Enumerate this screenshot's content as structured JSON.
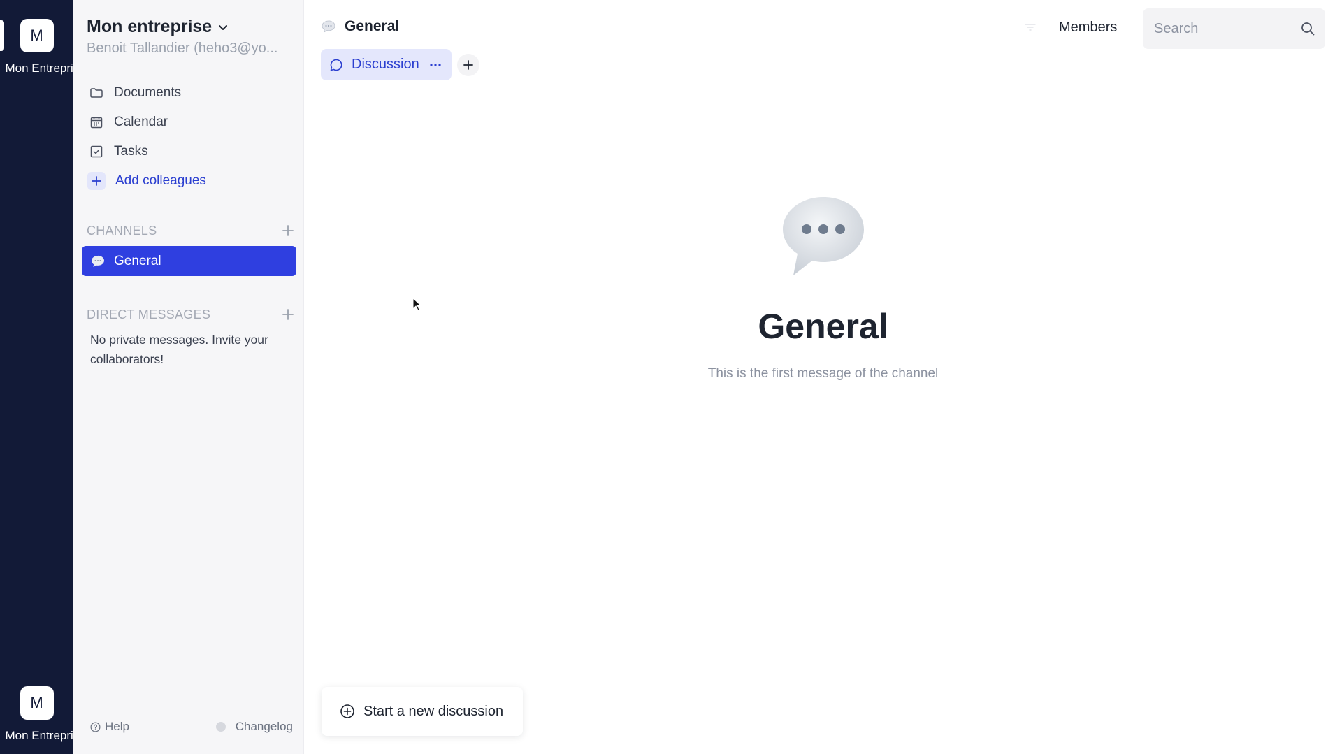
{
  "workspace_rail": {
    "items": [
      {
        "initial": "M",
        "name": "Mon Entreprise"
      },
      {
        "initial": "M",
        "name": "Mon Entreprise"
      }
    ]
  },
  "sidebar": {
    "org_name": "Mon entreprise",
    "user": "Benoit Tallandier (heho3@yo...",
    "nav": [
      {
        "label": "Documents",
        "icon": "folder-icon"
      },
      {
        "label": "Calendar",
        "icon": "calendar-icon"
      },
      {
        "label": "Tasks",
        "icon": "checkbox-icon"
      }
    ],
    "add_colleagues": "Add colleagues",
    "channels_title": "CHANNELS",
    "channels": [
      {
        "name": "General",
        "active": true
      }
    ],
    "dm_title": "DIRECT MESSAGES",
    "dm_empty": "No private messages. Invite your collaborators!",
    "footer": {
      "help": "Help",
      "changelog": "Changelog"
    }
  },
  "header": {
    "channel_name": "General",
    "members_label": "Members",
    "search_placeholder": "Search"
  },
  "tabs": [
    {
      "label": "Discussion",
      "active": true
    }
  ],
  "empty_state": {
    "title": "General",
    "subtitle": "This is the first message of the channel"
  },
  "composer": {
    "new_discussion": "Start a new discussion"
  },
  "colors": {
    "rail_bg": "#121a37",
    "accent": "#2f3fe0",
    "sidebar_bg": "#f6f6f8",
    "tab_active_bg": "#e4e7fc"
  }
}
